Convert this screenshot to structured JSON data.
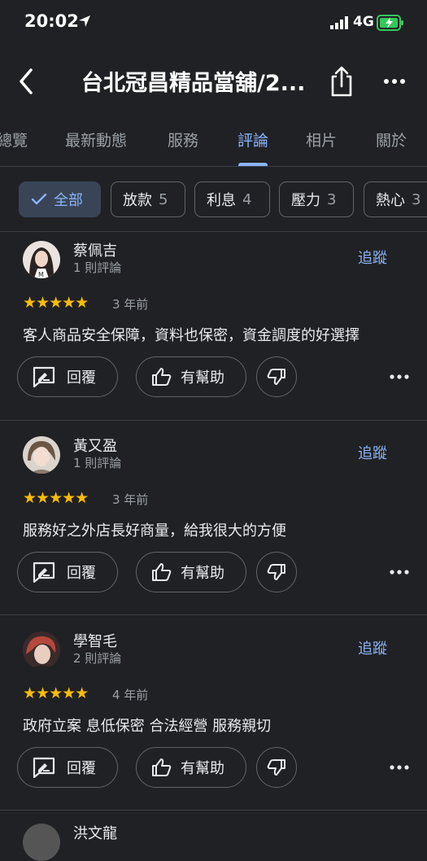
{
  "status_bar": {
    "time": "20:02",
    "network": "4G"
  },
  "header": {
    "title": "台北冠昌精品當舖/2..."
  },
  "tabs": [
    {
      "label": "總覽"
    },
    {
      "label": "最新動態"
    },
    {
      "label": "服務"
    },
    {
      "label": "評論",
      "active": true
    },
    {
      "label": "相片"
    },
    {
      "label": "關於"
    }
  ],
  "filters": [
    {
      "label": "全部",
      "selected": true
    },
    {
      "label": "放款",
      "count": "5"
    },
    {
      "label": "利息",
      "count": "4"
    },
    {
      "label": "壓力",
      "count": "3"
    },
    {
      "label": "熱心",
      "count": "3"
    }
  ],
  "actions": {
    "follow": "追蹤",
    "reply": "回覆",
    "helpful": "有幫助"
  },
  "colors": {
    "background": "#202124",
    "accent": "#8ab4f8",
    "star": "#fbbc04"
  },
  "reviews": [
    {
      "name": "蔡佩吉",
      "review_count": "1 則評論",
      "stars": "★★★★★",
      "rating": 5,
      "time": "3 年前",
      "text": "客人商品安全保障，資料也保密，資金調度的好選擇"
    },
    {
      "name": "黃又盈",
      "review_count": "1 則評論",
      "stars": "★★★★★",
      "rating": 5,
      "time": "3 年前",
      "text": "服務好之外店長好商量，給我很大的方便"
    },
    {
      "name": "學智毛",
      "review_count": "2 則評論",
      "stars": "★★★★★",
      "rating": 5,
      "time": "4 年前",
      "text": "政府立案 息低保密 合法經營 服務親切"
    }
  ],
  "next_review": {
    "name": "洪文龍"
  }
}
